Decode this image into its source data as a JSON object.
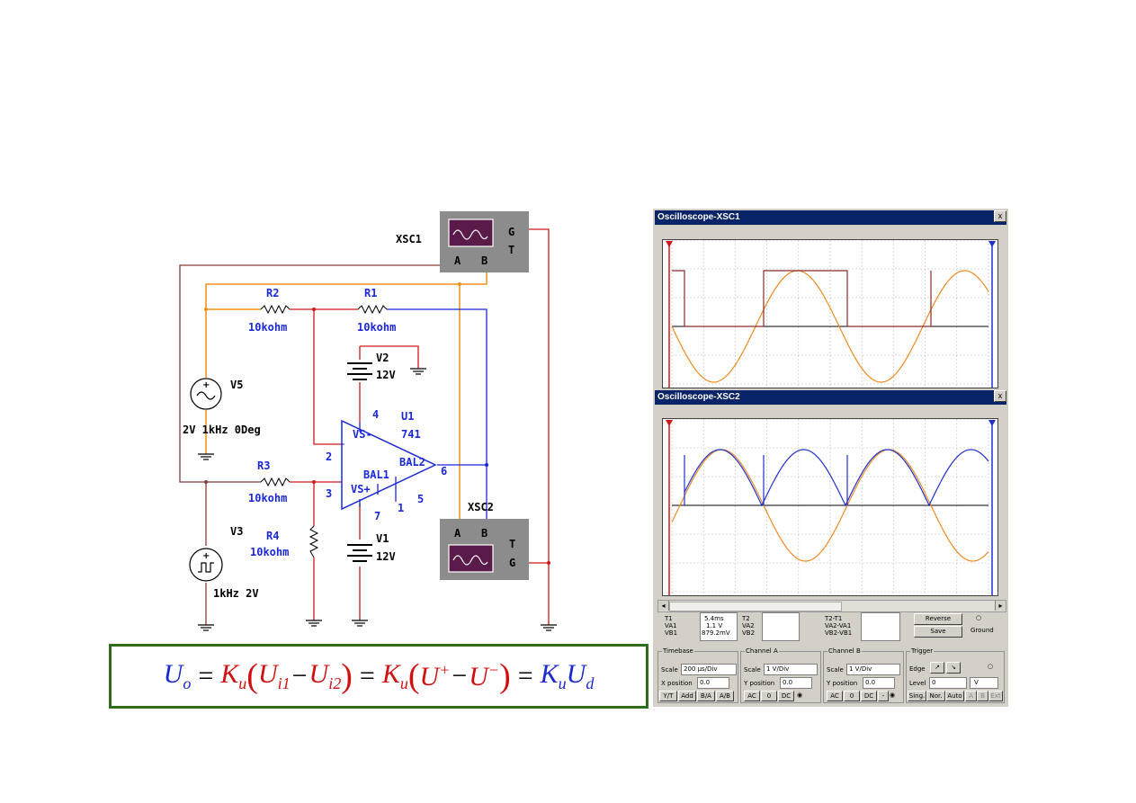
{
  "circuit": {
    "xsc1": {
      "name": "XSC1",
      "terminals": [
        "G",
        "T",
        "A",
        "B"
      ]
    },
    "xsc2": {
      "name": "XSC2",
      "terminals": [
        "T",
        "G",
        "A",
        "B"
      ]
    },
    "r2": {
      "name": "R2",
      "value": "10kohm"
    },
    "r1": {
      "name": "R1",
      "value": "10kohm"
    },
    "r3": {
      "name": "R3",
      "value": "10kohm"
    },
    "r4": {
      "name": "R4",
      "value": "10kohm"
    },
    "v2": {
      "name": "V2",
      "value": "12V"
    },
    "v1": {
      "name": "V1",
      "value": "12V"
    },
    "v5": {
      "name": "V5",
      "value": "2V 1kHz 0Deg"
    },
    "v3": {
      "name": "V3",
      "value": "1kHz  2V"
    },
    "u1": {
      "name": "U1",
      "model": "741",
      "vs_minus": "VS-",
      "vs_plus": "VS+",
      "bal2": "BAL2",
      "bal1": "BAL1",
      "pins": {
        "p2": "2",
        "p3": "3",
        "p4": "4",
        "p5": "5",
        "p6": "6",
        "p7": "7",
        "p1": "1"
      }
    }
  },
  "formula": {
    "uo_U": "U",
    "uo_sub": "o",
    "eq": "=",
    "k": "K",
    "k_sub": "u",
    "u": "U",
    "ui1_sub": "i1",
    "minus": "−",
    "ui2_sub": "i2",
    "uplus_sup": "+",
    "uminus_sup": "−",
    "d_sub": "d"
  },
  "osc1": {
    "title": "Oscilloscope-XSC1",
    "close": "x"
  },
  "osc2": {
    "title": "Oscilloscope-XSC2",
    "close": "x",
    "readout": {
      "t1": "T1",
      "va1": "VA1",
      "vb1": "VB1",
      "t1_val": "5.4ms",
      "va1_val": "1.1 V",
      "vb1_val": "879.2mV",
      "t2": "T2",
      "va2": "VA2",
      "vb2": "VB2",
      "t21": "T2-T1",
      "vb2va1": "VA2-VA1",
      "vb2vb1": "VB2-VB1",
      "reverse": "Reverse",
      "save": "Save",
      "ground": "Ground"
    },
    "timebase": {
      "title": "Timebase",
      "scale_label": "Scale",
      "scale": "200 µs/Div",
      "xpos_label": "X position",
      "xpos": "0.0",
      "yt": "Y/T",
      "add": "Add",
      "ba": "B/A",
      "ab": "A/B"
    },
    "channel_a": {
      "title": "Channel A",
      "scale_label": "Scale",
      "scale": "1 V/Div",
      "ypos_label": "Y position",
      "ypos": "0.0",
      "ac": "AC",
      "zero": "0",
      "dc": "DC"
    },
    "channel_b": {
      "title": "Channel B",
      "scale_label": "Scale",
      "scale": "1 V/Div",
      "ypos_label": "Y position",
      "ypos": "0.0",
      "ac": "AC",
      "zero": "0",
      "dc": "DC",
      "minus": "-"
    },
    "trigger": {
      "title": "Trigger",
      "edge_label": "Edge",
      "level_label": "Level",
      "level": "0",
      "unit": "V",
      "sing": "Sing.",
      "nor": "Nor.",
      "auto": "Auto",
      "a": "A",
      "b": "B",
      "ext": "Ext"
    }
  },
  "colors": {
    "wire_blue": "#1a28d8",
    "wire_orange": "#f0901a",
    "wire_red": "#d01818",
    "wire_brown": "#8b3b3b",
    "wire_black": "#000000",
    "osc_body": "#8c8c8c",
    "screen_purple": "#5a1a4a",
    "formula_border": "#2e6b1a",
    "trace_orange": "#f08a20",
    "trace_blue": "#2030d0",
    "trace_brown": "#8b2a2a"
  }
}
